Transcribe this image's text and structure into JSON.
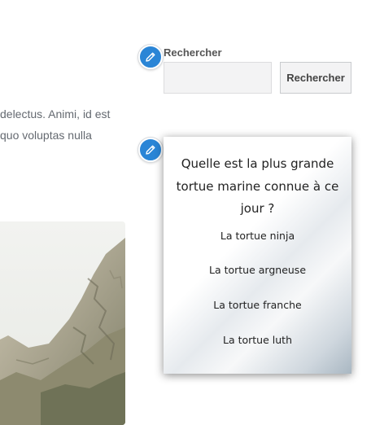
{
  "content": {
    "body_lines": [
      "delectus. Animi, id est",
      "quo voluptas nulla"
    ]
  },
  "search": {
    "label": "Rechercher",
    "placeholder": "",
    "value": "",
    "button_label": "Rechercher"
  },
  "quiz": {
    "question": "Quelle est la plus grande tortue marine connue à ce jour ?",
    "answers": [
      "La tortue ninja",
      "La tortue argneuse",
      "La tortue franche",
      "La tortue luth"
    ]
  },
  "icons": {
    "edit_search": "pencil-icon",
    "edit_quiz": "pencil-icon"
  },
  "colors": {
    "edit_icon_bg": "#2a85d6",
    "text_muted": "#646970"
  }
}
